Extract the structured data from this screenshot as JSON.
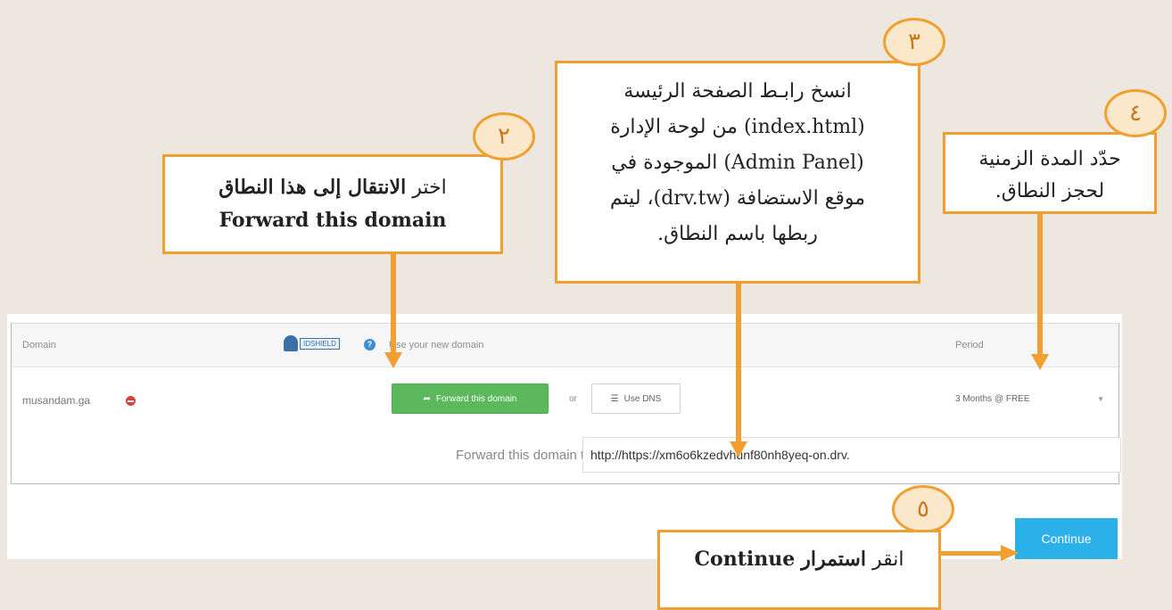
{
  "table": {
    "header_domain": "Domain",
    "header_use": "Use your new domain",
    "header_period": "Period",
    "idshield_label": "IDSHIELD",
    "help_icon_glyph": "?"
  },
  "row": {
    "domain": "musandam.ga",
    "forward_button": "Forward this domain",
    "or_text": "or",
    "dns_button": "Use DNS",
    "period_value": "3 Months @ FREE",
    "forward_label": "Forward this domain to",
    "forward_value": "http://https://xm6o6kzedvhunf80nh8yeq-on.drv."
  },
  "continue_button": "Continue",
  "callouts": {
    "c2": {
      "number": "٢",
      "line1_prefix": "اختر ",
      "line1_bold": "الانتقال إلى هذا النطاق",
      "line2": "Forward this domain"
    },
    "c3": {
      "number": "٣",
      "lines": [
        "انسخ رابـط الصفحة الرئيسة",
        "(index.html) من لوحة الإدارة",
        "(Admin Panel) الموجودة في",
        "موقع الاستضافة (drv.tw)، ليتم",
        "ربطها باسم النطاق."
      ]
    },
    "c4": {
      "number": "٤",
      "lines": [
        "حدّد المدة الزمنية",
        "لحجز النطاق."
      ]
    },
    "c5": {
      "number": "٥",
      "prefix": "انقر ",
      "bold_ar": "استمرار",
      "bold_en": "Continue"
    }
  },
  "colors": {
    "accent": "#f0a030",
    "background": "#ede7df",
    "forward_green": "#5cb85c",
    "continue_blue": "#2bb0ea"
  },
  "icons": [
    "share-arrow-icon",
    "list-icon",
    "chevron-down-icon",
    "remove-icon",
    "help-icon",
    "idshield-logo"
  ]
}
